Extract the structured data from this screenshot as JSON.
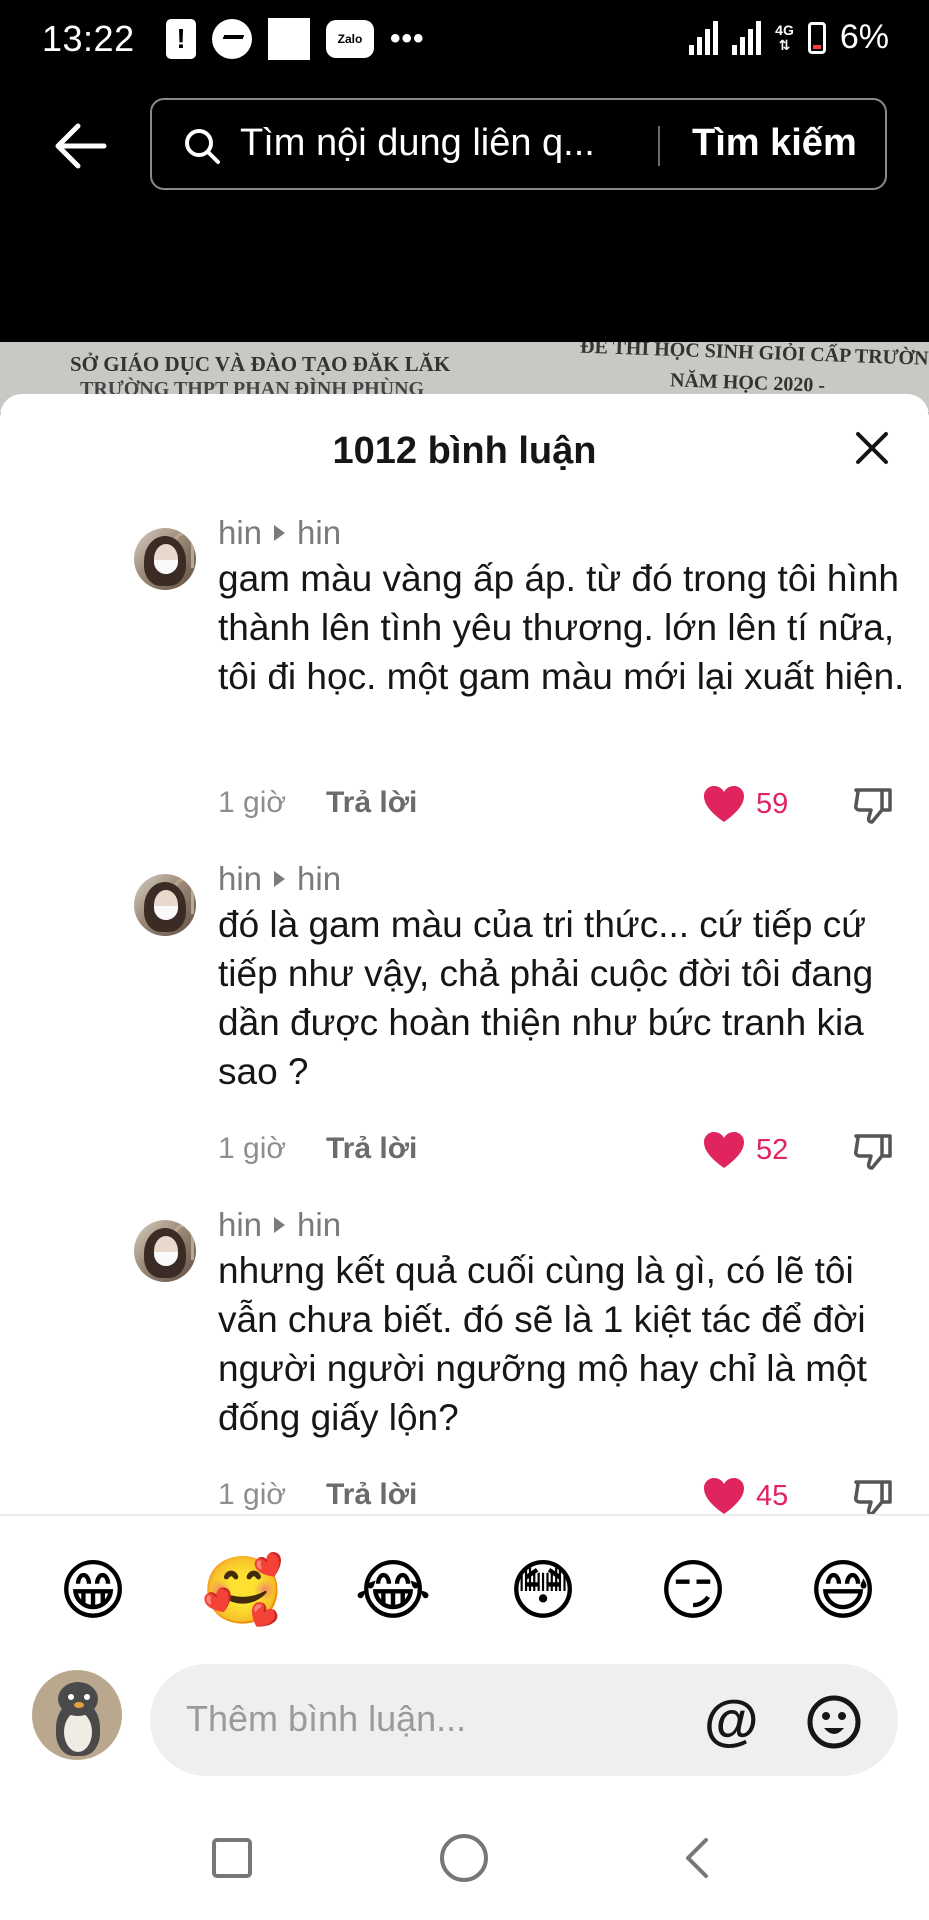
{
  "status_bar": {
    "time": "13:22",
    "zalo_label": "Zalo",
    "network": "4G",
    "battery": "6%",
    "icons": [
      "alert-icon",
      "messenger-icon",
      "square-icon",
      "zalo-icon",
      "more-dots-icon",
      "signal-icon",
      "signal-icon",
      "4g-icon",
      "battery-icon"
    ]
  },
  "header": {
    "search_text": "Tìm nội dung liên q...",
    "search_button": "Tìm kiếm"
  },
  "video_peek": {
    "line1": "SỞ GIÁO DỤC VÀ ĐÀO TẠO ĐĂK LĂK",
    "line2": "ĐỀ THI HỌC SINH GIỎI CẤP TRƯỜNG",
    "line3": "NĂM HỌC 2020 -",
    "line4": "TRƯỜNG THPT PHAN ĐÌNH PHÙNG"
  },
  "sheet": {
    "title": "1012 bình luận"
  },
  "comments": [
    {
      "author": "hin",
      "reply_to": "hin",
      "text": "gam màu vàng ấp áp. từ đó trong tôi hình thành lên tình yêu thương. lớn lên tí nữa, tôi đi học. một gam màu mới lại xuất hiện.",
      "time": "1 giờ",
      "reply_label": "Trả lời",
      "likes": "59"
    },
    {
      "author": "hin",
      "reply_to": "hin",
      "text": "đó là gam màu của tri thức... cứ tiếp cứ tiếp như vậy, chả phải cuộc đời tôi đang dần được hoàn thiện như bức tranh kia sao ?",
      "time": "1 giờ",
      "reply_label": "Trả lời",
      "likes": "52"
    },
    {
      "author": "hin",
      "reply_to": "hin",
      "text": "nhưng kết quả cuối cùng là gì, có lẽ tôi vẫn chưa biết. đó sẽ là 1 kiệt tác để đời người người ngưỡng mộ hay chỉ là một đống giấy lộn?",
      "time": "1 giờ",
      "reply_label": "Trả lời",
      "likes": "45"
    }
  ],
  "emojis": [
    "😁",
    "🥰",
    "😂",
    "😳",
    "😏",
    "😅"
  ],
  "composer": {
    "placeholder": "Thêm bình luận...",
    "mention_symbol": "@"
  },
  "colors": {
    "like_heart": "#e0245e",
    "sheet_bg": "#ffffff",
    "header_bg": "#000000"
  }
}
